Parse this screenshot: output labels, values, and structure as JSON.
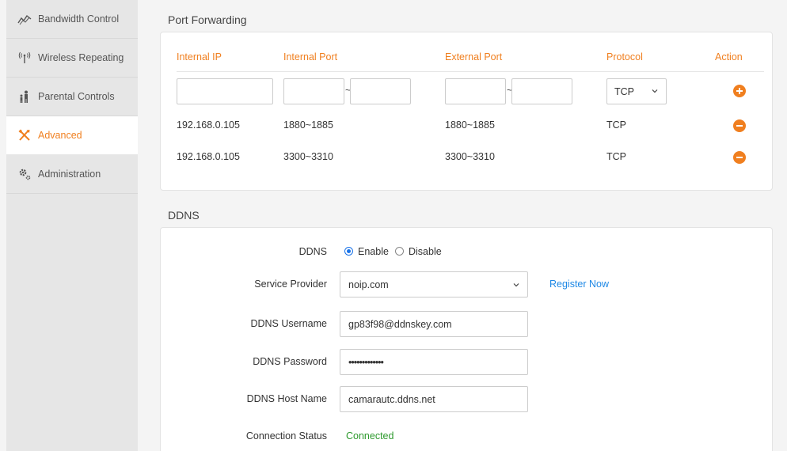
{
  "sidebar": {
    "items": [
      {
        "label": "Bandwidth Control",
        "icon": "bandwidth-icon"
      },
      {
        "label": "Wireless Repeating",
        "icon": "wireless-icon"
      },
      {
        "label": "Parental Controls",
        "icon": "parental-icon"
      },
      {
        "label": "Advanced",
        "icon": "tools-icon",
        "active": true
      },
      {
        "label": "Administration",
        "icon": "gears-icon"
      }
    ]
  },
  "port_forwarding": {
    "title": "Port Forwarding",
    "headers": {
      "internal_ip": "Internal IP",
      "internal_port": "Internal Port",
      "external_port": "External Port",
      "protocol": "Protocol",
      "action": "Action"
    },
    "new_row": {
      "internal_ip": "",
      "internal_port_start": "",
      "internal_port_end": "",
      "external_port_start": "",
      "external_port_end": "",
      "range_separator": "~",
      "protocol": "TCP"
    },
    "rows": [
      {
        "internal_ip": "192.168.0.105",
        "internal_port": "1880~1885",
        "external_port": "1880~1885",
        "protocol": "TCP"
      },
      {
        "internal_ip": "192.168.0.105",
        "internal_port": "3300~3310",
        "external_port": "3300~3310",
        "protocol": "TCP"
      }
    ]
  },
  "ddns": {
    "title": "DDNS",
    "ddns_label": "DDNS",
    "enable_label": "Enable",
    "disable_label": "Disable",
    "enabled": true,
    "provider_label": "Service Provider",
    "provider_value": "noip.com",
    "register_link": "Register Now",
    "username_label": "DDNS Username",
    "username_value": "gp83f98@ddnskey.com",
    "password_label": "DDNS Password",
    "password_value": "•••••••••••••",
    "hostname_label": "DDNS Host Name",
    "hostname_value": "camarautc.ddns.net",
    "status_label": "Connection Status",
    "status_value": "Connected"
  },
  "colors": {
    "accent": "#f07f1f",
    "link": "#1e88e5",
    "success": "#2e9a2e"
  }
}
